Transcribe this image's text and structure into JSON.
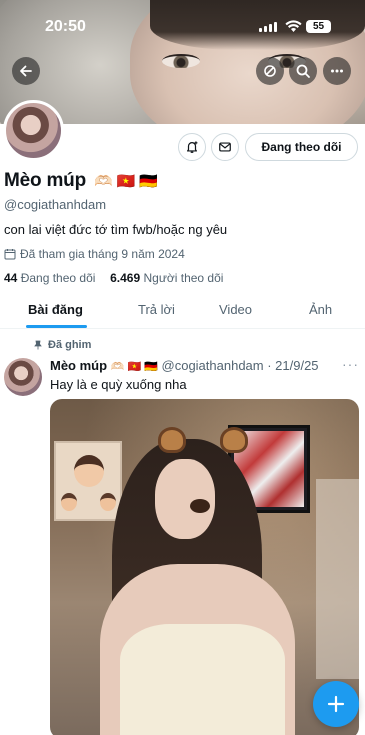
{
  "status_bar": {
    "time": "20:50",
    "battery": "55"
  },
  "header": {
    "back_icon": "arrow-left-icon",
    "actions": [
      "grok-icon",
      "search-icon",
      "more-icon"
    ]
  },
  "profile": {
    "name": "Mèo múp",
    "name_emojis": "🫶🏻 🇻🇳 🇩🇪",
    "handle": "@cogiathanhdam",
    "bio": "con lai việt đức tớ tìm fwb/hoặc ng yêu",
    "joined": "Đã tham gia tháng 9 năm 2024",
    "following_count": "44",
    "following_label": "Đang theo dõi",
    "followers_count": "6.469",
    "followers_label": "Người theo dõi",
    "follow_button": "Đang theo dõi"
  },
  "tabs": [
    {
      "label": "Bài đăng",
      "active": true
    },
    {
      "label": "Trả lời",
      "active": false
    },
    {
      "label": "Video",
      "active": false
    },
    {
      "label": "Ảnh",
      "active": false
    }
  ],
  "post": {
    "pinned_label": "Đã ghim",
    "author": "Mèo múp",
    "author_emojis": "🫶🏻 🇻🇳 🇩🇪",
    "handle_date": "@cogiathanhdam · 21/9/25",
    "more": "···",
    "text": "Hay là e quỳ xuống nha"
  },
  "colors": {
    "accent": "#1d9bf0",
    "text": "#0f1419",
    "muted": "#536471"
  }
}
